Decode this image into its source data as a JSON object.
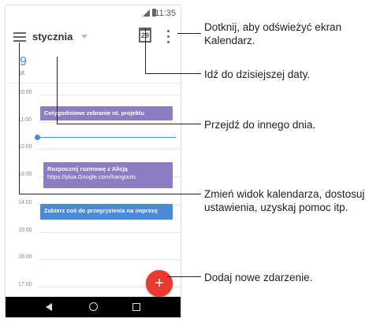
{
  "status": {
    "time": "11:35"
  },
  "appbar": {
    "month": "stycznia",
    "today_day": "29"
  },
  "day_header": {
    "date": "9",
    "weekday": "pt."
  },
  "hours": [
    "10:00",
    "11:00",
    "12:00",
    "13:00",
    "14:00",
    "15:00",
    "16:00",
    "17:00"
  ],
  "events": [
    {
      "title": "Cotygodniowe zebranie nt. projektu",
      "detail": "",
      "color": "#8e7cc3"
    },
    {
      "title": "Rozpocznij rozmowę z Alicją",
      "detail": "https://plua.Google.com/hangouts",
      "color": "#8e7cc3"
    },
    {
      "title": "Zabierz coś do przegryzienia na imprezę",
      "detail": "",
      "color": "#4a8ad8"
    }
  ],
  "fab": {
    "symbol": "+"
  },
  "callouts": [
    "Dotknij, aby odświeżyć ekran Kalendarz.",
    "Idź do dzisiejszej daty.",
    "Przejdź do innego dnia.",
    "Zmień widok kalendarza, dostosuj ustawienia, uzyskaj pomoc itp.",
    "Dodaj nowe zdarzenie."
  ],
  "colors": {
    "accent": "#4a8ad8",
    "fab": "#e63b2e",
    "event_purple": "#8e7cc3"
  }
}
